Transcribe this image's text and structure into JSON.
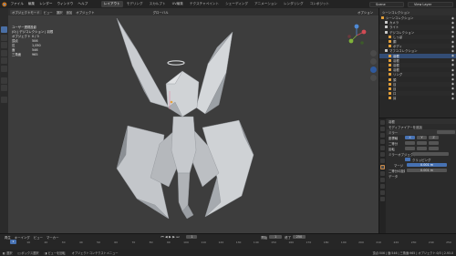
{
  "menu": [
    "ファイル",
    "編集",
    "レンダー",
    "ウィンドウ",
    "ヘルプ"
  ],
  "workspaces": [
    "レイアウト",
    "モデリング",
    "スカルプト",
    "UV編集",
    "テクスチャペイント",
    "シェーディング",
    "アニメーション",
    "レンダリング",
    "コンポジット"
  ],
  "active_workspace": 0,
  "scene_name": "Scene",
  "view_layer": "View Layer",
  "viewport": {
    "mode": "オブジェクトモード",
    "menus": [
      "ビュー",
      "選択",
      "追加",
      "オブジェクト"
    ],
    "transform": "グローバル",
    "stats_title": "ユーザー透視投影",
    "stats_sub": "(0) | デジコレクション | 羽根",
    "stats_rows": [
      {
        "label": "オブジェクト",
        "value": "0 / 3"
      },
      {
        "label": "頂点",
        "value": "506"
      },
      {
        "label": "辺",
        "value": "1,050"
      },
      {
        "label": "面",
        "value": "546"
      },
      {
        "label": "三角面",
        "value": "965"
      }
    ],
    "options_label": "オプション"
  },
  "outliner": {
    "title": "シーンコレクション",
    "rows": [
      {
        "label": "シーンコレクション",
        "indent": 0
      },
      {
        "label": "カメラ",
        "indent": 1
      },
      {
        "label": "ライト",
        "indent": 1
      },
      {
        "label": "デジコレクション",
        "indent": 1
      },
      {
        "label": "しっぽ",
        "indent": 2
      },
      {
        "label": "胴",
        "indent": 2
      },
      {
        "label": "ボディ",
        "indent": 2
      },
      {
        "label": "マフユコレクション",
        "indent": 1
      },
      {
        "label": "羽根",
        "indent": 2
      },
      {
        "label": "羽根",
        "indent": 2
      },
      {
        "label": "羽根",
        "indent": 2
      },
      {
        "label": "羽根",
        "indent": 2
      },
      {
        "label": "リング",
        "indent": 2
      },
      {
        "label": "頭",
        "indent": 2
      },
      {
        "label": "目",
        "indent": 2
      },
      {
        "label": "目",
        "indent": 2
      },
      {
        "label": "口",
        "indent": 2
      },
      {
        "label": "耳",
        "indent": 2
      }
    ],
    "selected_row": 8
  },
  "properties": {
    "object_name": "羽根",
    "modifier_tab": "モディファイアーを追加",
    "modifier_name": "ミラー",
    "axis_label": "座標軸",
    "bisect_label": "二等分",
    "flip_label": "反転",
    "axes": [
      "X",
      "Y",
      "Z"
    ],
    "mirror_object": "ミラーオブジェクト",
    "clipping": "クリッピング",
    "merge": "マージ",
    "merge_value": "0.001 m",
    "bisect_dist": "二等分の距離",
    "bisect_value": "0.001 m",
    "data": "データ"
  },
  "timeline": {
    "menus": [
      "再生",
      "キーイング",
      "ビュー",
      "マーカー"
    ],
    "current_frame": "1",
    "start_label": "開始",
    "start": "1",
    "end_label": "終了",
    "end": "250",
    "ticks": [
      "0",
      "10",
      "20",
      "30",
      "40",
      "50",
      "60",
      "70",
      "80",
      "90",
      "100",
      "110",
      "120",
      "130",
      "140",
      "150",
      "160",
      "170",
      "180",
      "190",
      "200",
      "210",
      "220",
      "230",
      "240",
      "250"
    ]
  },
  "statusbar": {
    "select": "選択",
    "box_select": "ボックス選択",
    "rotate": "ビューを回転",
    "context": "オブジェクトコンテクストメニュー",
    "version": "頂点:506 | 面:546 | 三角面:965 | オブジェクト:0/3 | 2.93.0"
  },
  "colors": {
    "accent": "#4772b3",
    "active_orange": "#e5a13a",
    "viewport_bg": "#3d3d3d",
    "mesh": "#b9bcc0"
  }
}
